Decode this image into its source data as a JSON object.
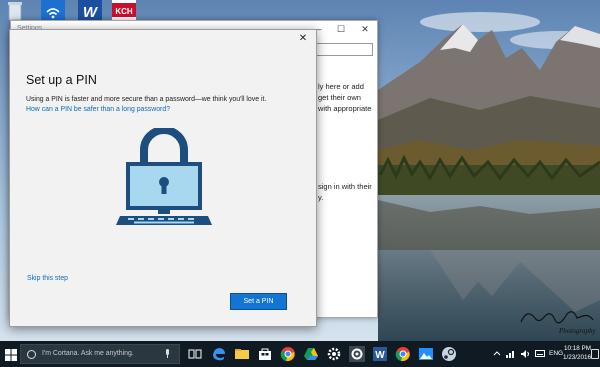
{
  "desktop": {
    "icons": [
      "recycle-bin",
      "wifi",
      "w-app",
      "kch-app"
    ],
    "kch_label": "KCH",
    "signature": "Photography"
  },
  "settings_window": {
    "title": "Settings",
    "controls": {
      "minimize": "—",
      "maximize": "☐",
      "close": "✕"
    },
    "text": [
      "ly here or add",
      "get their own",
      "with appropriate",
      "sign in with their",
      "y."
    ]
  },
  "pin_dialog": {
    "close": "✕",
    "title": "Set up a PIN",
    "description": "Using a PIN is faster and more secure than a password—we think you'll love it.",
    "link": "How can a PIN be safer than a long password?",
    "skip": "Skip this step",
    "button": "Set a PIN"
  },
  "taskbar": {
    "search_placeholder": "I'm Cortana. Ask me anything.",
    "pinned": [
      "task-view",
      "edge",
      "file-explorer",
      "store",
      "chrome",
      "google-drive",
      "gear",
      "settings",
      "word",
      "chrome-2",
      "photos",
      "steam"
    ],
    "language": "ENG",
    "time": "10:18 PM",
    "date": "1/23/2016"
  },
  "colors": {
    "accent": "#1474d4",
    "link": "#0f6cbd",
    "taskbar": "#0f1a22",
    "lock_body": "#a8d8f0",
    "lock_navy": "#1d4e7e"
  }
}
